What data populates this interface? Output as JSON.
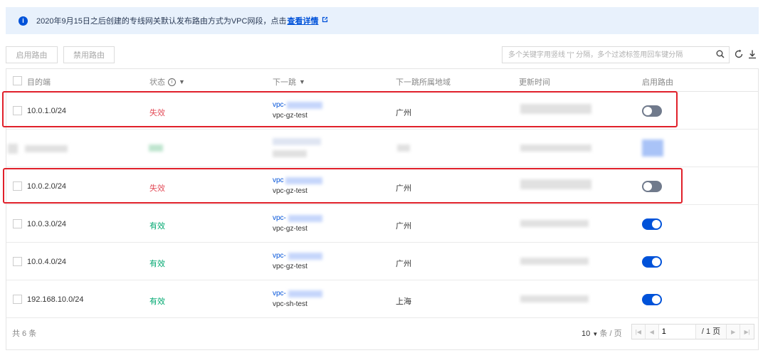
{
  "notice": {
    "text": "2020年9月15日之后创建的专线网关默认发布路由方式为VPC网段，点击",
    "link": "查看详情"
  },
  "toolbar": {
    "enable_label": "启用路由",
    "disable_label": "禁用路由",
    "search_placeholder": "多个关键字用竖线 \"|\" 分隔，多个过滤标签用回车键分隔"
  },
  "table": {
    "headers": {
      "dest": "目的端",
      "status": "状态",
      "nexthop": "下一跳",
      "region": "下一跳所属地域",
      "updated": "更新时间",
      "enabled": "启用路由"
    },
    "rows": [
      {
        "dest": "10.0.1.0/24",
        "status": "失效",
        "status_type": "invalid",
        "hop_id": "vpc-",
        "hop_name": "vpc-gz-test",
        "region": "广州",
        "enabled": false
      },
      {
        "dest": "",
        "status": "",
        "status_type": "hidden",
        "hop_id": "",
        "hop_name": "",
        "region": "",
        "enabled": true
      },
      {
        "dest": "10.0.2.0/24",
        "status": "失效",
        "status_type": "invalid",
        "hop_id": "vpc",
        "hop_name": "vpc-gz-test",
        "region": "广州",
        "enabled": false
      },
      {
        "dest": "10.0.3.0/24",
        "status": "有效",
        "status_type": "valid",
        "hop_id": "vpc-",
        "hop_name": "vpc-gz-test",
        "region": "广州",
        "enabled": true
      },
      {
        "dest": "10.0.4.0/24",
        "status": "有效",
        "status_type": "valid",
        "hop_id": "vpc-",
        "hop_name": "vpc-gz-test",
        "region": "广州",
        "enabled": true
      },
      {
        "dest": "192.168.10.0/24",
        "status": "有效",
        "status_type": "valid",
        "hop_id": "vpc-",
        "hop_name": "vpc-sh-test",
        "region": "上海",
        "enabled": true
      }
    ]
  },
  "footer": {
    "total": "共 6 条",
    "page_size": "10",
    "page_size_unit": "条 / 页",
    "current_page": "1",
    "page_count": "/ 1 页"
  },
  "colors": {
    "accent": "#0052d9",
    "invalid": "#e34d59",
    "valid": "#00a870",
    "highlight": "#e0202a"
  }
}
